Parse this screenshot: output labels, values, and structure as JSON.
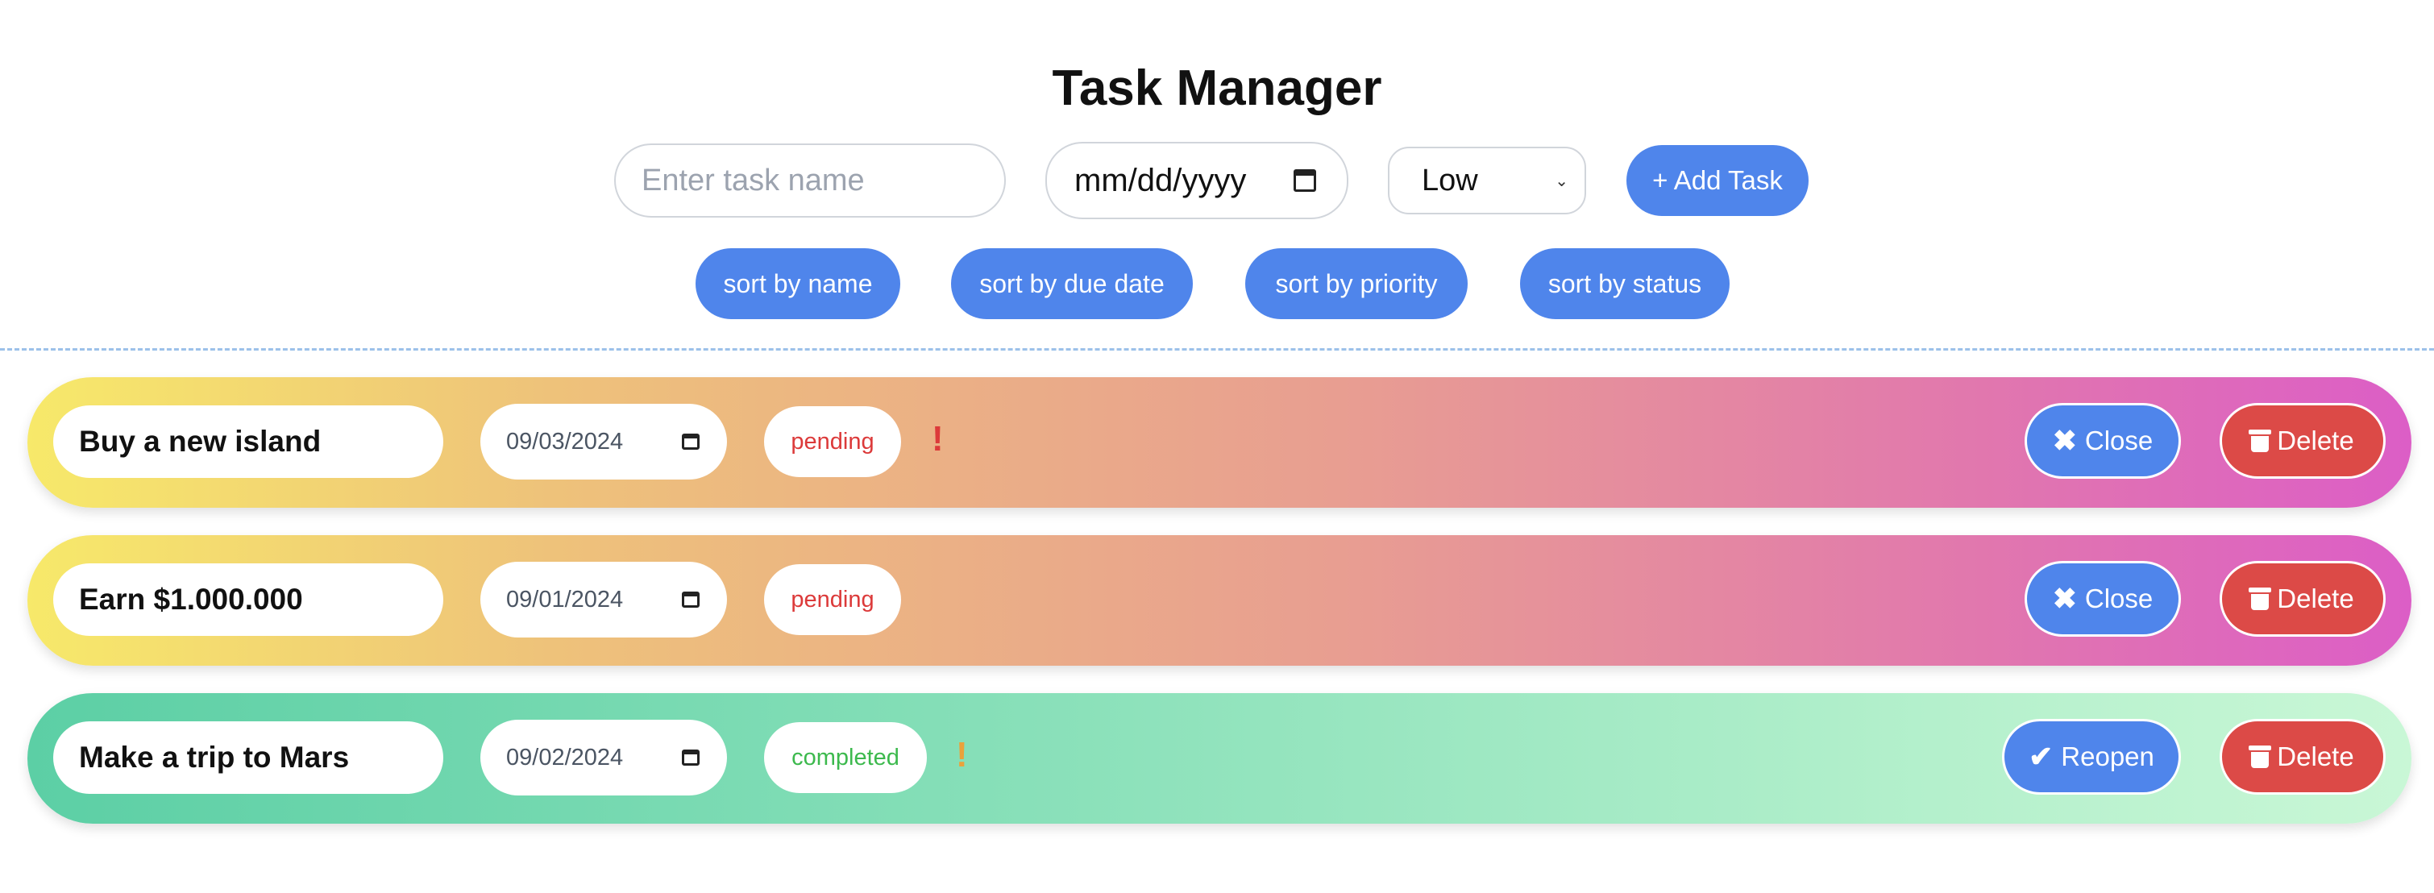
{
  "header": {
    "title": "Task Manager"
  },
  "form": {
    "task_name_placeholder": "Enter task name",
    "due_date_value": "mm/dd/yyyy",
    "priority_selected": "Low",
    "add_label": "+ Add Task"
  },
  "sort": {
    "by_name": "sort by name",
    "by_due_date": "sort by due date",
    "by_priority": "sort by priority",
    "by_status": "sort by status"
  },
  "colors": {
    "accent": "#4f85eb",
    "danger": "#dc4a47",
    "pending_text": "#dc3a3a",
    "completed_text": "#3cb94d",
    "priority_high": "#dc3a3a",
    "priority_medium": "#e9a23b"
  },
  "tasks": [
    {
      "name": "Buy a new island",
      "due_date": "09/03/2024",
      "status": "pending",
      "priority_mark": "!",
      "toggle_label": "Close",
      "toggle_icon": "close-icon",
      "delete_label": "Delete",
      "delete_icon": "trash-icon"
    },
    {
      "name": "Earn $1.000.000",
      "due_date": "09/01/2024",
      "status": "pending",
      "priority_mark": "",
      "toggle_label": "Close",
      "toggle_icon": "close-icon",
      "delete_label": "Delete",
      "delete_icon": "trash-icon"
    },
    {
      "name": "Make a trip to Mars",
      "due_date": "09/02/2024",
      "status": "completed",
      "priority_mark": "!",
      "toggle_label": "Reopen",
      "toggle_icon": "check-icon",
      "delete_label": "Delete",
      "delete_icon": "trash-icon"
    }
  ]
}
